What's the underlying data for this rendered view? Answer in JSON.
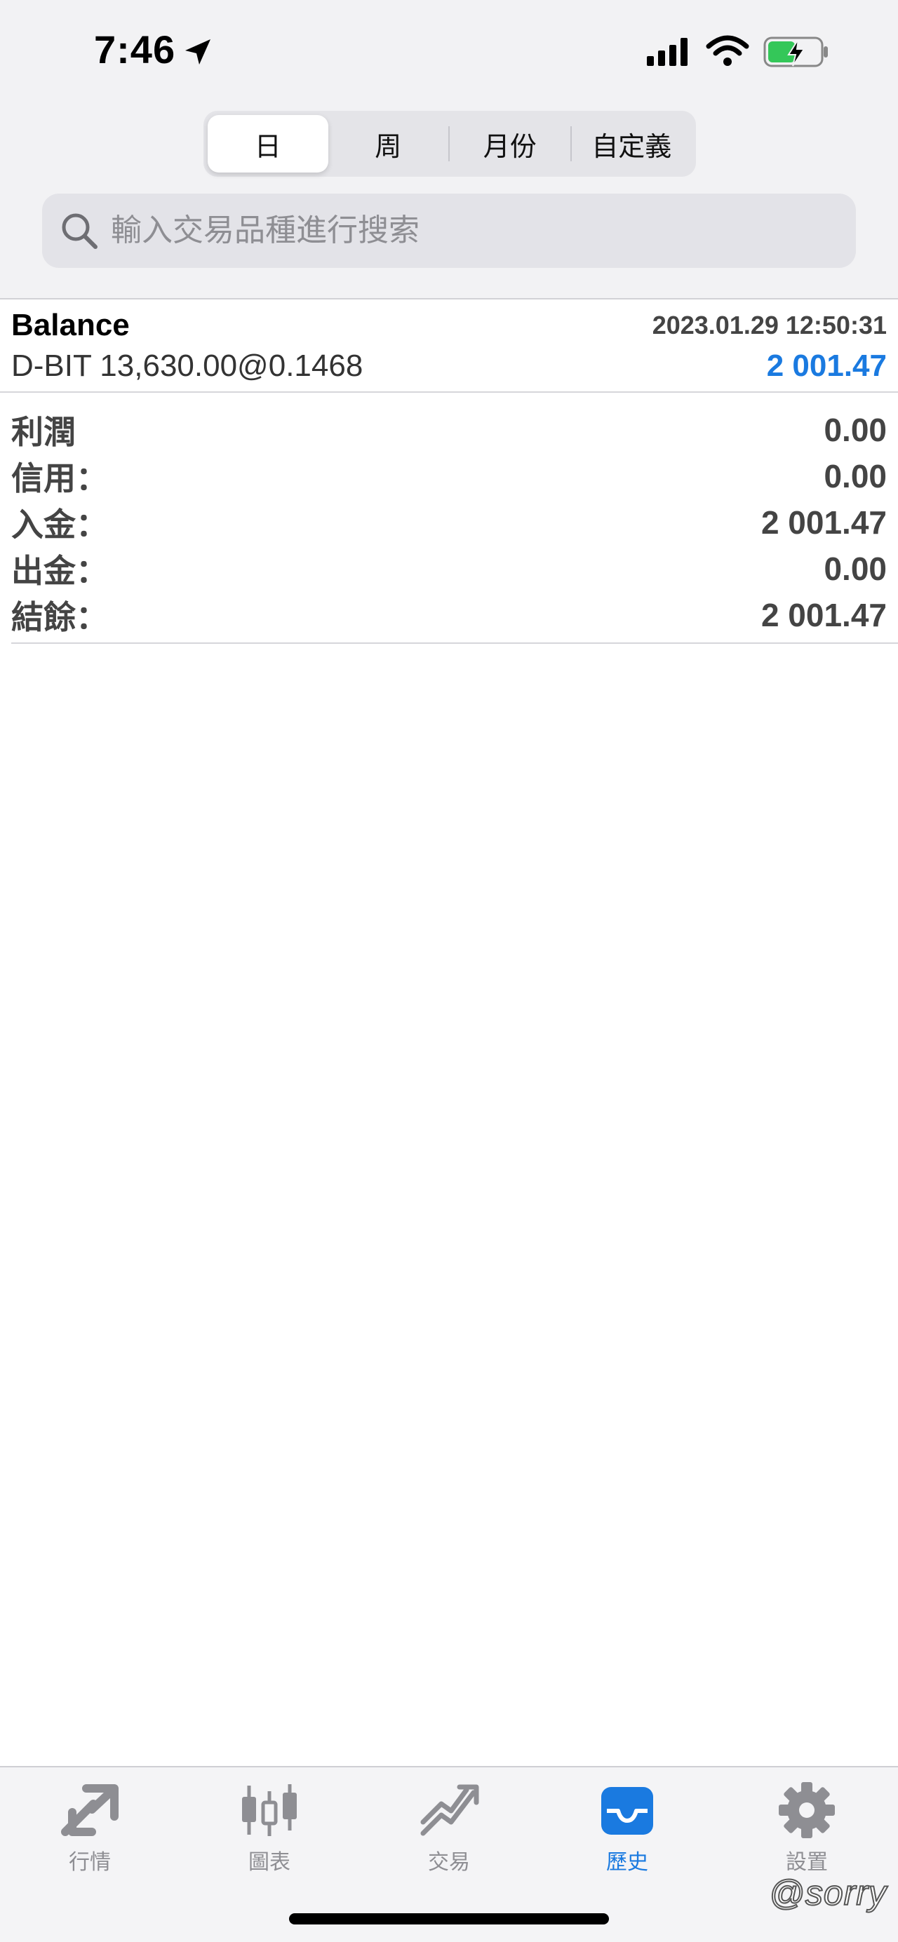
{
  "status_bar": {
    "time": "7:46",
    "icons": [
      "location-arrow-icon",
      "cellular-signal-icon",
      "wifi-icon",
      "battery-charging-icon"
    ]
  },
  "period_segments": [
    "日",
    "周",
    "月份",
    "自定義"
  ],
  "active_segment": "日",
  "search": {
    "placeholder": "輸入交易品種進行搜索",
    "value": ""
  },
  "deal": {
    "type": "Balance",
    "timestamp": "2023.01.29 12:50:31",
    "description": "D-BIT 13,630.00@0.1468",
    "amount": "2 001.47"
  },
  "summary": [
    {
      "label": "利潤",
      "value": "0.00"
    },
    {
      "label": "信用：",
      "value": "0.00"
    },
    {
      "label": "入金：",
      "value": "2 001.47"
    },
    {
      "label": "出金：",
      "value": "0.00"
    },
    {
      "label": "結餘：",
      "value": "2 001.47"
    }
  ],
  "tabbar": {
    "items": [
      {
        "label": "行情",
        "icon": "quotes-arrows-icon"
      },
      {
        "label": "圖表",
        "icon": "candlestick-chart-icon"
      },
      {
        "label": "交易",
        "icon": "trade-trend-icon"
      },
      {
        "label": "歷史",
        "icon": "history-tray-icon"
      },
      {
        "label": "設置",
        "icon": "settings-gear-icon"
      }
    ],
    "active": "歷史"
  },
  "colors": {
    "accent": "#1a7ae0",
    "inactive": "#8e8e93",
    "battery_green": "#34c759"
  },
  "watermark": "@sorry"
}
